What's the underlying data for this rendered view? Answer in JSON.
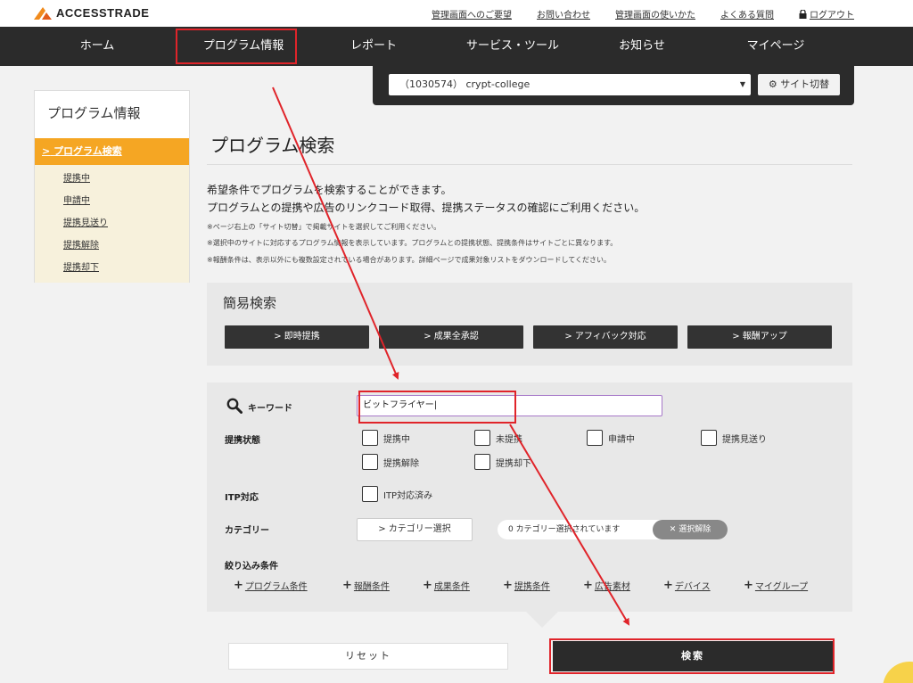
{
  "header": {
    "logo_text": "ACCESSTRADE",
    "links": [
      "管理画面へのご要望",
      "お問い合わせ",
      "管理画面の使いかた",
      "よくある質問"
    ],
    "logout": "ログアウト"
  },
  "nav": {
    "items": [
      "ホーム",
      "プログラム情報",
      "レポート",
      "サービス・ツール",
      "お知らせ",
      "マイページ"
    ],
    "active": "プログラム情報"
  },
  "site": {
    "selected": "（1030574） crypt-college",
    "switch_label": "サイト切替"
  },
  "sidebar": {
    "title": "プログラム情報",
    "active_item": "プログラム検索",
    "items": [
      "提携中",
      "申請中",
      "提携見送り",
      "提携解除",
      "提携却下"
    ]
  },
  "main": {
    "title": "プログラム検索",
    "desc1": "希望条件でプログラムを検索することができます。",
    "desc2": "プログラムとの提携や広告のリンクコード取得、提携ステータスの確認にご利用ください。",
    "notes": [
      "※ページ右上の「サイト切替」で掲載サイトを選択してご利用ください。",
      "※選択中のサイトに対応するプログラム情報を表示しています。プログラムとの提携状態、提携条件はサイトごとに異なります。",
      "※報酬条件は、表示以外にも複数設定されている場合があります。詳細ページで成果対象リストをダウンロードしてください。"
    ]
  },
  "simple": {
    "title": "簡易検索",
    "buttons": [
      "即時提携",
      "成果全承認",
      "アフィバック対応",
      "報酬アップ"
    ]
  },
  "search": {
    "keyword_label": "キーワード",
    "keyword_value": "ビットフライヤー",
    "status_label": "提携状態",
    "status_options": [
      "提携中",
      "未提携",
      "申請中",
      "提携見送り",
      "提携解除",
      "提携却下"
    ],
    "itp_label": "ITP対応",
    "itp_option": "ITP対応済み",
    "category_label": "カテゴリー",
    "category_button": "カテゴリー選択",
    "category_status": "0 カテゴリー選択されています",
    "category_clear": "選択解除",
    "filter_label": "絞り込み条件",
    "filters": [
      "プログラム条件",
      "報酬条件",
      "成果条件",
      "提携条件",
      "広告素材",
      "デバイス",
      "マイグループ"
    ]
  },
  "actions": {
    "reset": "リセット",
    "search": "検索"
  },
  "colors": {
    "accent": "#f5a623",
    "dark": "#2b2b2b",
    "annotation": "#e0242a"
  }
}
